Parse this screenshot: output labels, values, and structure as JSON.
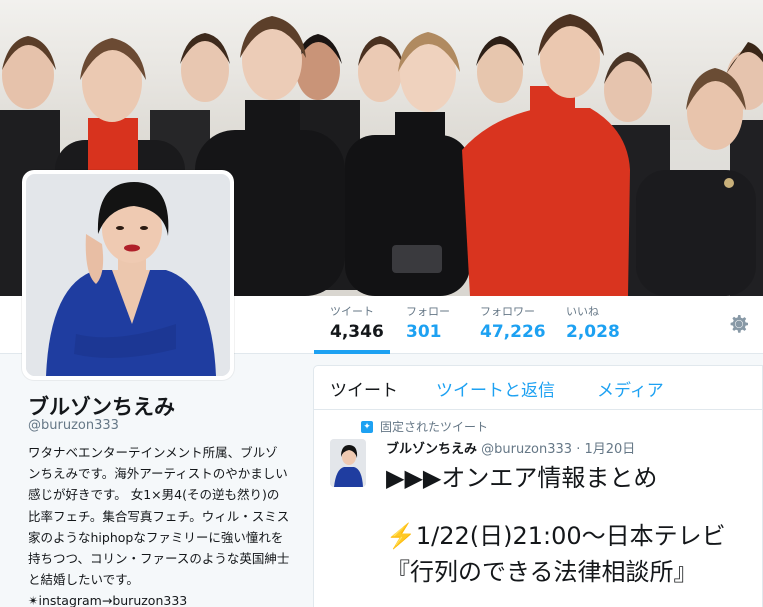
{
  "stats": [
    {
      "label": "ツイート",
      "value": "4,346"
    },
    {
      "label": "フォロー",
      "value": "301"
    },
    {
      "label": "フォロワー",
      "value": "47,226"
    },
    {
      "label": "いいね",
      "value": "2,028"
    }
  ],
  "profile": {
    "name": "ブルゾンちえみ",
    "handle": "@buruzon333",
    "bio": "ワタナベエンターテインメント所属、ブルゾンちえみです。海外アーティストのやかましい感じが好きです。 女1×男4(その逆も然り)の比率フェチ。集合写真フェチ。ウィル・スミス家のようなhiphopなファミリーに強い憧れを持ちつつ、コリン・ファースのような英国紳士と結婚したいです。✴︎instagram→buruzon333"
  },
  "tabs": {
    "tweets": "ツイート",
    "replies": "ツイートと返信",
    "media": "メディア"
  },
  "pinned": {
    "label": "固定されたツイート",
    "author": "ブルゾンちえみ",
    "meta": "@buruzon333 · 1月20日",
    "line1": "▶︎▶︎▶︎オンエア情報まとめ",
    "line2": "⚡️1/22(日)21:00〜日本テレビ",
    "line3": "『行列のできる法律相談所』"
  },
  "icons": {
    "settings": "gear-icon",
    "pin": "pin-icon"
  },
  "colors": {
    "accent": "#1da1f2",
    "text": "#14171a",
    "muted": "#657786"
  }
}
